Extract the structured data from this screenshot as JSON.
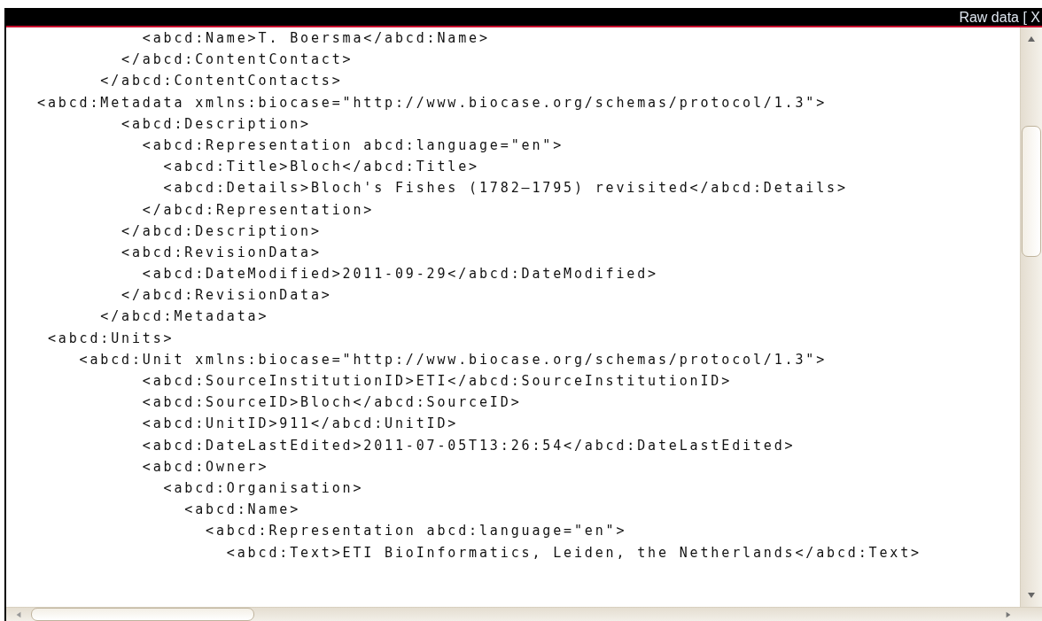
{
  "panel": {
    "title": "Raw data [ X"
  },
  "lines": [
    "          <abcd:Name>T. Boersma</abcd:Name>",
    "        </abcd:ContentContact>",
    "      </abcd:ContentContacts>",
    "<abcd:Metadata xmlns:biocase=\"http://www.biocase.org/schemas/protocol/1.3\">",
    "        <abcd:Description>",
    "          <abcd:Representation abcd:language=\"en\">",
    "            <abcd:Title>Bloch</abcd:Title>",
    "            <abcd:Details>Bloch's Fishes (1782–1795) revisited</abcd:Details>",
    "          </abcd:Representation>",
    "        </abcd:Description>",
    "        <abcd:RevisionData>",
    "          <abcd:DateModified>2011-09-29</abcd:DateModified>",
    "        </abcd:RevisionData>",
    "      </abcd:Metadata>",
    " <abcd:Units>",
    "    <abcd:Unit xmlns:biocase=\"http://www.biocase.org/schemas/protocol/1.3\">",
    "          <abcd:SourceInstitutionID>ETI</abcd:SourceInstitutionID>",
    "          <abcd:SourceID>Bloch</abcd:SourceID>",
    "          <abcd:UnitID>911</abcd:UnitID>",
    "          <abcd:DateLastEdited>2011-07-05T13:26:54</abcd:DateLastEdited>",
    "          <abcd:Owner>",
    "            <abcd:Organisation>",
    "              <abcd:Name>",
    "                <abcd:Representation abcd:language=\"en\">",
    "                  <abcd:Text>ETI BioInformatics, Leiden, the Netherlands</abcd:Text>"
  ]
}
